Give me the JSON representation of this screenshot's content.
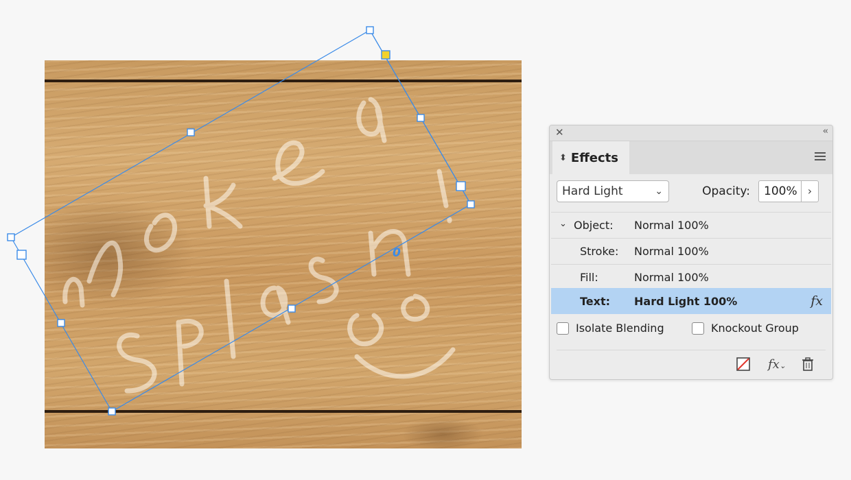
{
  "artwork": {
    "text_art": "make a Splash!",
    "handle_colors": {
      "frame": "#3b8be8",
      "corner_active": "#f2d22b"
    }
  },
  "panel": {
    "close_icon": "close-icon",
    "collapse_icon": "collapse-icon",
    "title": "Effects",
    "blend_mode": "Hard Light",
    "opacity_label": "Opacity:",
    "opacity_value": "100%",
    "rows": [
      {
        "name": "Object:",
        "value": "Normal 100%"
      },
      {
        "name": "Stroke:",
        "value": "Normal 100%"
      },
      {
        "name": "Fill:",
        "value": "Normal 100%"
      },
      {
        "name": "Text:",
        "value": "Hard Light 100%"
      }
    ],
    "fx_label": "fx",
    "isolate_blending": "Isolate Blending",
    "knockout_group": "Knockout Group",
    "colors": {
      "selected_row": "#b3d3f3",
      "panel_bg": "#ececec"
    }
  }
}
